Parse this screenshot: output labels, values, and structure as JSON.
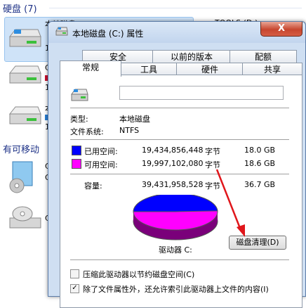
{
  "explorer": {
    "hard_disks_title": "硬盘 (7)",
    "removable_title": "有可移动",
    "drive_c_label": "本地磁盘 (C:)",
    "drive_tools_label": "TOOLS (D:)",
    "frag_c1": "C",
    "frag_c2": "本",
    "frag_c3": "C",
    "frag_g": "G",
    "frag_c4": "C",
    "frag_1a": "1",
    "frag_1b": "1",
    "frag_1c": "1"
  },
  "dialog": {
    "title": "本地磁盘 (C:) 属性",
    "close_label": "X",
    "tabs_row1": [
      "安全",
      "以前的版本",
      "配额"
    ],
    "tabs_row2": [
      "常规",
      "工具",
      "硬件",
      "共享"
    ],
    "general": {
      "type_label": "类型:",
      "type_value": "本地磁盘",
      "fs_label": "文件系统:",
      "fs_value": "NTFS",
      "used_label": "已用空间:",
      "used_bytes": "19,434,856,448",
      "used_unit": "字节",
      "used_gb": "18.0 GB",
      "free_label": "可用空间:",
      "free_bytes": "19,997,102,080",
      "free_unit": "字节",
      "free_gb": "18.6 GB",
      "capacity_label": "容量:",
      "capacity_bytes": "39,431,958,528",
      "capacity_unit": "字节",
      "capacity_gb": "36.7 GB",
      "drive_label": "驱动器 C:",
      "cleanup_button": "磁盘清理(D)",
      "compress_label": "压缩此驱动器以节约磁盘空间(C)",
      "index_label": "除了文件属性外，还允许索引此驱动器上文件的内容(I)"
    },
    "colors": {
      "used": "#0000ff",
      "free": "#ff00ff",
      "arrow": "#e0161b"
    },
    "usage_fraction": 0.493
  }
}
